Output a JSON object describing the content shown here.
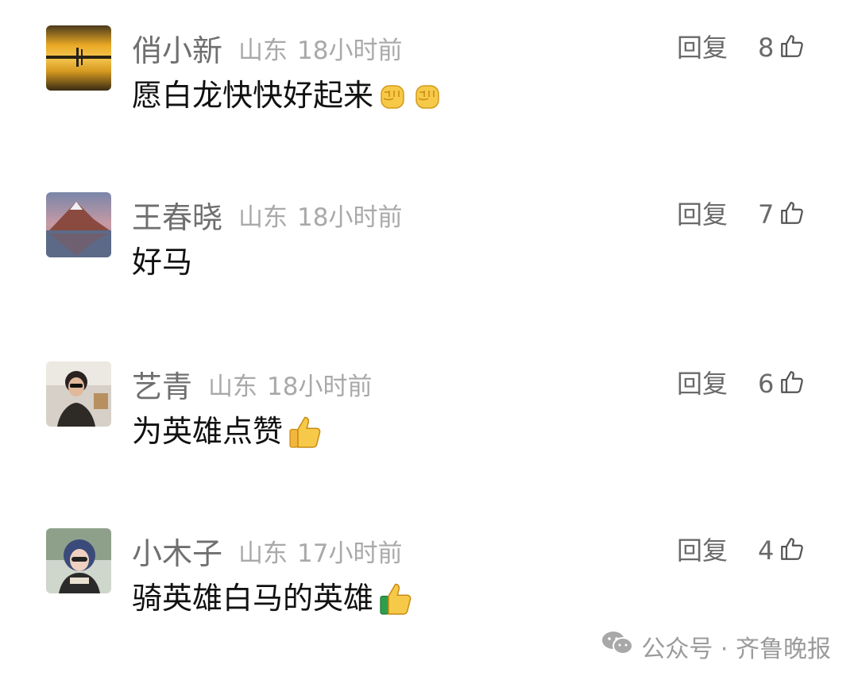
{
  "comments": [
    {
      "name": "俏小新",
      "location": "山东",
      "time": "18小时前",
      "reply_label": "回复",
      "likes": "8",
      "text": "愿白龙快快好起来",
      "emoji": [
        "raised-fist",
        "raised-fist"
      ]
    },
    {
      "name": "王春晓",
      "location": "山东",
      "time": "18小时前",
      "reply_label": "回复",
      "likes": "7",
      "text": "好马",
      "emoji": []
    },
    {
      "name": "艺青",
      "location": "山东",
      "time": "18小时前",
      "reply_label": "回复",
      "likes": "6",
      "text": "为英雄点赞",
      "emoji": [
        "thumbs-up"
      ]
    },
    {
      "name": "小木子",
      "location": "山东",
      "time": "17小时前",
      "reply_label": "回复",
      "likes": "4",
      "text": "骑英雄白马的英雄",
      "emoji": [
        "thumbs-up"
      ]
    }
  ],
  "watermark": {
    "text": "公众号 · 齐鲁晚报",
    "icon": "wechat-icon"
  },
  "colors": {
    "name": "#6f6f6f",
    "meta": "#a9a9a9",
    "body": "#111111",
    "action": "#6a6a6a"
  }
}
